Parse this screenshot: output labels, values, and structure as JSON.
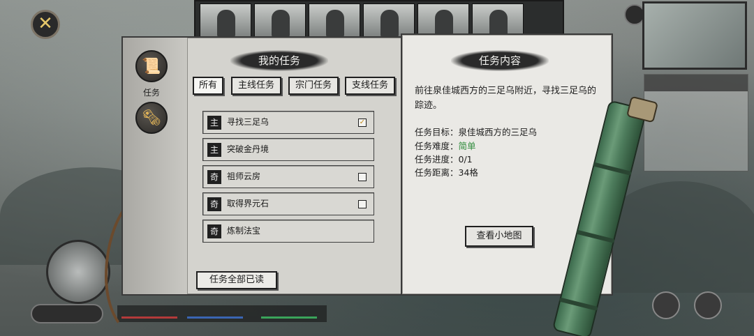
{
  "window": {
    "close_icon": "crossed-swords-icon"
  },
  "sidebar": {
    "items": [
      {
        "icon": "scroll-icon",
        "label": "任务"
      },
      {
        "icon": "paper-icon",
        "label": ""
      }
    ]
  },
  "quest_panel": {
    "title": "我的任务",
    "tabs": [
      {
        "label": "所有",
        "active": true
      },
      {
        "label": "主线任务",
        "active": false
      },
      {
        "label": "宗门任务",
        "active": false
      },
      {
        "label": "支线任务",
        "active": false
      }
    ],
    "tasks": [
      {
        "badge": "主",
        "name": "寻找三足乌",
        "checkbox": true,
        "checked": true
      },
      {
        "badge": "主",
        "name": "突破金丹境",
        "checkbox": false,
        "checked": false
      },
      {
        "badge": "奇",
        "name": "祖师云房",
        "checkbox": true,
        "checked": false
      },
      {
        "badge": "奇",
        "name": "取得界元石",
        "checkbox": true,
        "checked": false
      },
      {
        "badge": "奇",
        "name": "炼制法宝",
        "checkbox": false,
        "checked": false
      }
    ],
    "read_all_button": "任务全部已读"
  },
  "detail_panel": {
    "title": "任务内容",
    "description": "前往泉佳城西方的三足乌附近，寻找三足乌的踪迹。",
    "fields": [
      {
        "label": "任务目标：",
        "value": "泉佳城西方的三足乌",
        "style": "normal"
      },
      {
        "label": "任务难度：",
        "value": "简单",
        "style": "easy"
      },
      {
        "label": "任务进度：",
        "value": "0/1",
        "style": "normal"
      },
      {
        "label": "任务距离：",
        "value": "34格",
        "style": "normal"
      }
    ],
    "minimap_button": "查看小地图"
  },
  "colors": {
    "easy": "#2e8b3b",
    "check": "#c48b1b"
  }
}
